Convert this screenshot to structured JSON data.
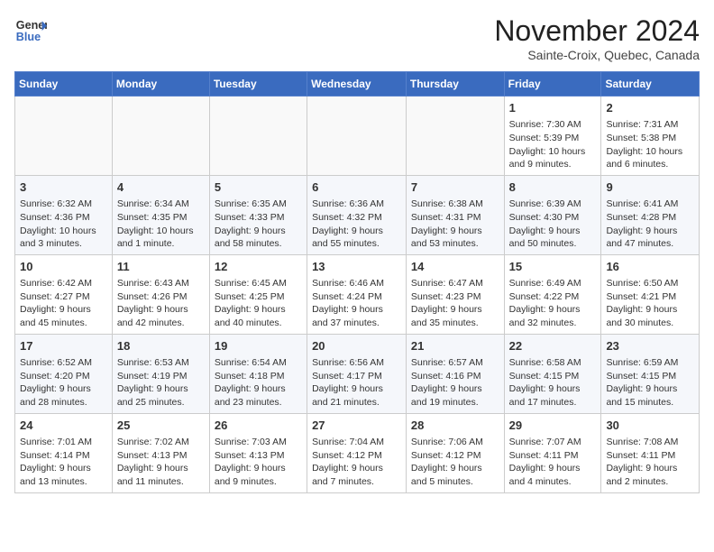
{
  "logo": {
    "line1": "General",
    "line2": "Blue"
  },
  "title": "November 2024",
  "subtitle": "Sainte-Croix, Quebec, Canada",
  "days_of_week": [
    "Sunday",
    "Monday",
    "Tuesday",
    "Wednesday",
    "Thursday",
    "Friday",
    "Saturday"
  ],
  "weeks": [
    [
      {
        "day": "",
        "info": ""
      },
      {
        "day": "",
        "info": ""
      },
      {
        "day": "",
        "info": ""
      },
      {
        "day": "",
        "info": ""
      },
      {
        "day": "",
        "info": ""
      },
      {
        "day": "1",
        "info": "Sunrise: 7:30 AM\nSunset: 5:39 PM\nDaylight: 10 hours and 9 minutes."
      },
      {
        "day": "2",
        "info": "Sunrise: 7:31 AM\nSunset: 5:38 PM\nDaylight: 10 hours and 6 minutes."
      }
    ],
    [
      {
        "day": "3",
        "info": "Sunrise: 6:32 AM\nSunset: 4:36 PM\nDaylight: 10 hours and 3 minutes."
      },
      {
        "day": "4",
        "info": "Sunrise: 6:34 AM\nSunset: 4:35 PM\nDaylight: 10 hours and 1 minute."
      },
      {
        "day": "5",
        "info": "Sunrise: 6:35 AM\nSunset: 4:33 PM\nDaylight: 9 hours and 58 minutes."
      },
      {
        "day": "6",
        "info": "Sunrise: 6:36 AM\nSunset: 4:32 PM\nDaylight: 9 hours and 55 minutes."
      },
      {
        "day": "7",
        "info": "Sunrise: 6:38 AM\nSunset: 4:31 PM\nDaylight: 9 hours and 53 minutes."
      },
      {
        "day": "8",
        "info": "Sunrise: 6:39 AM\nSunset: 4:30 PM\nDaylight: 9 hours and 50 minutes."
      },
      {
        "day": "9",
        "info": "Sunrise: 6:41 AM\nSunset: 4:28 PM\nDaylight: 9 hours and 47 minutes."
      }
    ],
    [
      {
        "day": "10",
        "info": "Sunrise: 6:42 AM\nSunset: 4:27 PM\nDaylight: 9 hours and 45 minutes."
      },
      {
        "day": "11",
        "info": "Sunrise: 6:43 AM\nSunset: 4:26 PM\nDaylight: 9 hours and 42 minutes."
      },
      {
        "day": "12",
        "info": "Sunrise: 6:45 AM\nSunset: 4:25 PM\nDaylight: 9 hours and 40 minutes."
      },
      {
        "day": "13",
        "info": "Sunrise: 6:46 AM\nSunset: 4:24 PM\nDaylight: 9 hours and 37 minutes."
      },
      {
        "day": "14",
        "info": "Sunrise: 6:47 AM\nSunset: 4:23 PM\nDaylight: 9 hours and 35 minutes."
      },
      {
        "day": "15",
        "info": "Sunrise: 6:49 AM\nSunset: 4:22 PM\nDaylight: 9 hours and 32 minutes."
      },
      {
        "day": "16",
        "info": "Sunrise: 6:50 AM\nSunset: 4:21 PM\nDaylight: 9 hours and 30 minutes."
      }
    ],
    [
      {
        "day": "17",
        "info": "Sunrise: 6:52 AM\nSunset: 4:20 PM\nDaylight: 9 hours and 28 minutes."
      },
      {
        "day": "18",
        "info": "Sunrise: 6:53 AM\nSunset: 4:19 PM\nDaylight: 9 hours and 25 minutes."
      },
      {
        "day": "19",
        "info": "Sunrise: 6:54 AM\nSunset: 4:18 PM\nDaylight: 9 hours and 23 minutes."
      },
      {
        "day": "20",
        "info": "Sunrise: 6:56 AM\nSunset: 4:17 PM\nDaylight: 9 hours and 21 minutes."
      },
      {
        "day": "21",
        "info": "Sunrise: 6:57 AM\nSunset: 4:16 PM\nDaylight: 9 hours and 19 minutes."
      },
      {
        "day": "22",
        "info": "Sunrise: 6:58 AM\nSunset: 4:15 PM\nDaylight: 9 hours and 17 minutes."
      },
      {
        "day": "23",
        "info": "Sunrise: 6:59 AM\nSunset: 4:15 PM\nDaylight: 9 hours and 15 minutes."
      }
    ],
    [
      {
        "day": "24",
        "info": "Sunrise: 7:01 AM\nSunset: 4:14 PM\nDaylight: 9 hours and 13 minutes."
      },
      {
        "day": "25",
        "info": "Sunrise: 7:02 AM\nSunset: 4:13 PM\nDaylight: 9 hours and 11 minutes."
      },
      {
        "day": "26",
        "info": "Sunrise: 7:03 AM\nSunset: 4:13 PM\nDaylight: 9 hours and 9 minutes."
      },
      {
        "day": "27",
        "info": "Sunrise: 7:04 AM\nSunset: 4:12 PM\nDaylight: 9 hours and 7 minutes."
      },
      {
        "day": "28",
        "info": "Sunrise: 7:06 AM\nSunset: 4:12 PM\nDaylight: 9 hours and 5 minutes."
      },
      {
        "day": "29",
        "info": "Sunrise: 7:07 AM\nSunset: 4:11 PM\nDaylight: 9 hours and 4 minutes."
      },
      {
        "day": "30",
        "info": "Sunrise: 7:08 AM\nSunset: 4:11 PM\nDaylight: 9 hours and 2 minutes."
      }
    ]
  ]
}
